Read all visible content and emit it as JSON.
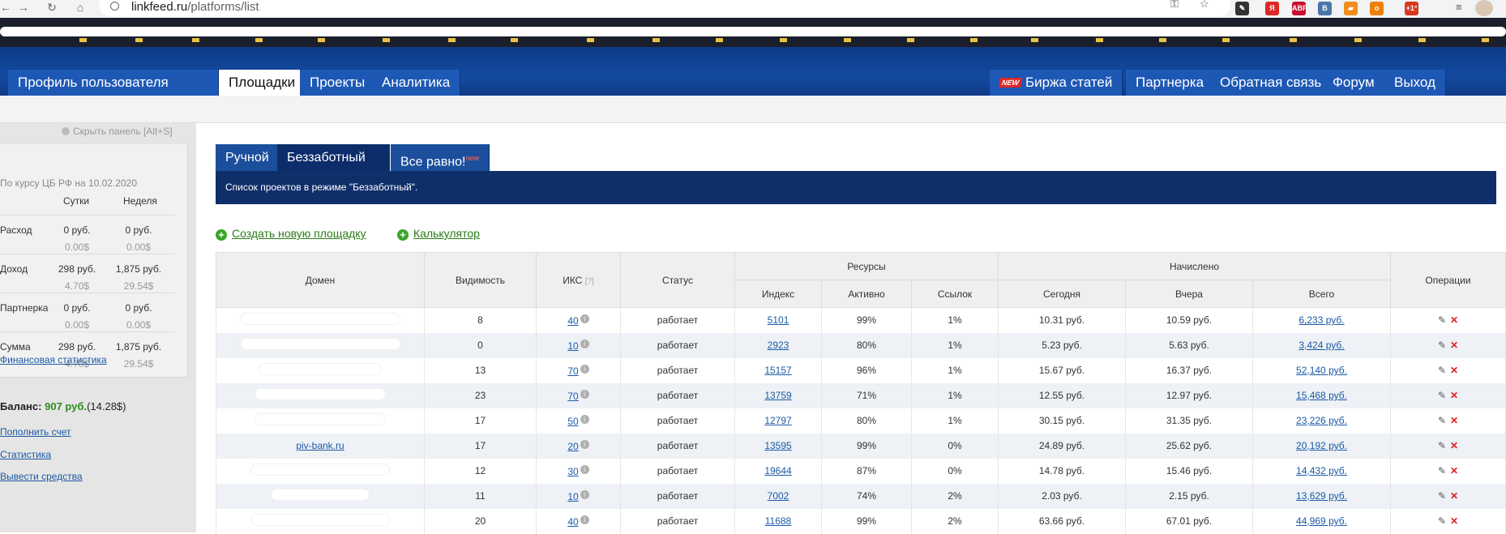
{
  "browser": {
    "url_domain": "linkfeed.ru",
    "url_path": "/platforms/list",
    "extensions": [
      {
        "name": "pen-icon",
        "label": "✎",
        "color": "#333333"
      },
      {
        "name": "yandex-icon",
        "label": "Я",
        "color": "#e02626"
      },
      {
        "name": "adblock-icon",
        "label": "ABP",
        "color": "#c8102e"
      },
      {
        "name": "vk-icon",
        "label": "В",
        "color": "#4a76a8"
      },
      {
        "name": "rss-icon",
        "label": "▰",
        "color": "#f28c1b"
      },
      {
        "name": "ok-icon",
        "label": "о",
        "color": "#ee8208"
      },
      {
        "name": "temperature-icon",
        "label": "+1°",
        "color": "#d9381e"
      }
    ]
  },
  "header": {
    "left_menu": [
      "Профиль пользователя",
      "Площадки",
      "Проекты",
      "Аналитика"
    ],
    "active": "Площадки",
    "new_badge": "NEW",
    "right_menu": [
      "Биржа статей",
      "Партнерка",
      "Обратная связь",
      "Форум",
      "Выход"
    ]
  },
  "sidebar": {
    "hide_panel": "Скрыть панель [Alt+S]",
    "rate_note": "По курсу ЦБ РФ на 10.02.2020",
    "col_day": "Сутки",
    "col_week": "Неделя",
    "rows": [
      {
        "label": "Расход",
        "day_rub": "0 руб.",
        "day_usd": "0.00$",
        "week_rub": "0 руб.",
        "week_usd": "0.00$"
      },
      {
        "label": "Доход",
        "day_rub": "298 руб.",
        "day_usd": "4.70$",
        "week_rub": "1,875 руб.",
        "week_usd": "29.54$"
      },
      {
        "label": "Партнерка",
        "day_rub": "0 руб.",
        "day_usd": "0.00$",
        "week_rub": "0 руб.",
        "week_usd": "0.00$"
      },
      {
        "label": "Сумма",
        "day_rub": "298 руб.",
        "day_usd": "4.70$",
        "week_rub": "1,875 руб.",
        "week_usd": "29.54$"
      }
    ],
    "fin_stats_link": "Финансовая статистика",
    "balance_label": "Баланс:",
    "balance_rub": "907 руб.",
    "balance_usd": "(14.28$)",
    "links": [
      "Пополнить счет",
      "Статистика",
      "Вывести средства"
    ]
  },
  "main": {
    "tabs": [
      "Ручной",
      "Беззаботный",
      "Все равно!"
    ],
    "tab_new_mark": "new",
    "active_tab": "Беззаботный",
    "info_text": "Список проектов в режиме \"Беззаботный\".",
    "actions": [
      "Создать новую площадку",
      "Калькулятор"
    ]
  },
  "table": {
    "headers": {
      "domain": "Домен",
      "visibility": "Видимость",
      "iks": "ИКС",
      "iks_hint": "[?]",
      "status": "Статус",
      "resources": "Ресурсы",
      "index": "Индекс",
      "active": "Активно",
      "links": "Ссылок",
      "accrued": "Начислено",
      "today": "Сегодня",
      "yesterday": "Вчера",
      "total": "Всего",
      "operations": "Операции"
    },
    "rows": [
      {
        "domain": "",
        "visibility": "8",
        "iks": "40",
        "status": "работает",
        "index": "5101",
        "active": "99%",
        "links": "1%",
        "today": "10.31 руб.",
        "yesterday": "10.59 руб.",
        "total": "6,233 руб."
      },
      {
        "domain": "",
        "visibility": "0",
        "iks": "10",
        "status": "работает",
        "index": "2923",
        "active": "80%",
        "links": "1%",
        "today": "5.23 руб.",
        "yesterday": "5.63 руб.",
        "total": "3,424 руб."
      },
      {
        "domain": "",
        "visibility": "13",
        "iks": "70",
        "status": "работает",
        "index": "15157",
        "active": "96%",
        "links": "1%",
        "today": "15.67 руб.",
        "yesterday": "16.37 руб.",
        "total": "52,140 руб."
      },
      {
        "domain": "",
        "visibility": "23",
        "iks": "70",
        "status": "работает",
        "index": "13759",
        "active": "71%",
        "links": "1%",
        "today": "12.55 руб.",
        "yesterday": "12.97 руб.",
        "total": "15,468 руб."
      },
      {
        "domain": "",
        "visibility": "17",
        "iks": "50",
        "status": "работает",
        "index": "12797",
        "active": "80%",
        "links": "1%",
        "today": "30.15 руб.",
        "yesterday": "31.35 руб.",
        "total": "23,226 руб."
      },
      {
        "domain": "piv-bank.ru",
        "visibility": "17",
        "iks": "20",
        "status": "работает",
        "index": "13595",
        "active": "99%",
        "links": "0%",
        "today": "24.89 руб.",
        "yesterday": "25.62 руб.",
        "total": "20,192 руб."
      },
      {
        "domain": "",
        "visibility": "12",
        "iks": "30",
        "status": "работает",
        "index": "19644",
        "active": "87%",
        "links": "0%",
        "today": "14.78 руб.",
        "yesterday": "15.46 руб.",
        "total": "14,432 руб."
      },
      {
        "domain": "",
        "visibility": "11",
        "iks": "10",
        "status": "работает",
        "index": "7002",
        "active": "74%",
        "links": "2%",
        "today": "2.03 руб.",
        "yesterday": "2.15 руб.",
        "total": "13,629 руб."
      },
      {
        "domain": "",
        "visibility": "20",
        "iks": "40",
        "status": "работает",
        "index": "11688",
        "active": "99%",
        "links": "2%",
        "today": "63.66 руб.",
        "yesterday": "67.01 руб.",
        "total": "44,969 руб."
      }
    ]
  }
}
